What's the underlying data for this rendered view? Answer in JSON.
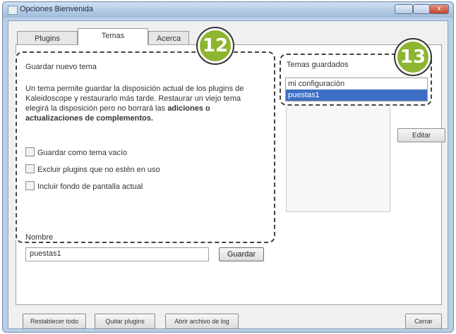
{
  "window": {
    "title": "Opciones Bienvenida",
    "close_glyph": "x"
  },
  "tabs": [
    "Plugins",
    "Temas",
    "Acerca"
  ],
  "buttons": {
    "side_button": "Editar",
    "restore": "Restablecer todo",
    "remove_plugins": "Quitar plugins",
    "open_config": "Abrir archivo de log",
    "close": "Cerrar"
  },
  "callout12": {
    "badge": "12",
    "section_title": "Guardar nuevo tema",
    "description": "Un tema permite guardar la disposición actual de los plugins de Kaleidoscope y restaurarlo más tarde. Restaurar un viejo tema elegirá la disposición pero no borrará las",
    "description_bold": "adiciones o actualizaciones de complementos.",
    "checkboxes": [
      "Guardar como tema vacío",
      "Excluir plugins que no estén en uso",
      "Incluir fondo de pantalla actual"
    ],
    "name_label": "Nombre",
    "name_value": "puestas1",
    "save_label": "Guardar"
  },
  "callout13": {
    "badge": "13",
    "title": "Temas guardados",
    "items": [
      "mi configuración",
      "puestas1"
    ],
    "selected_index": 1
  }
}
